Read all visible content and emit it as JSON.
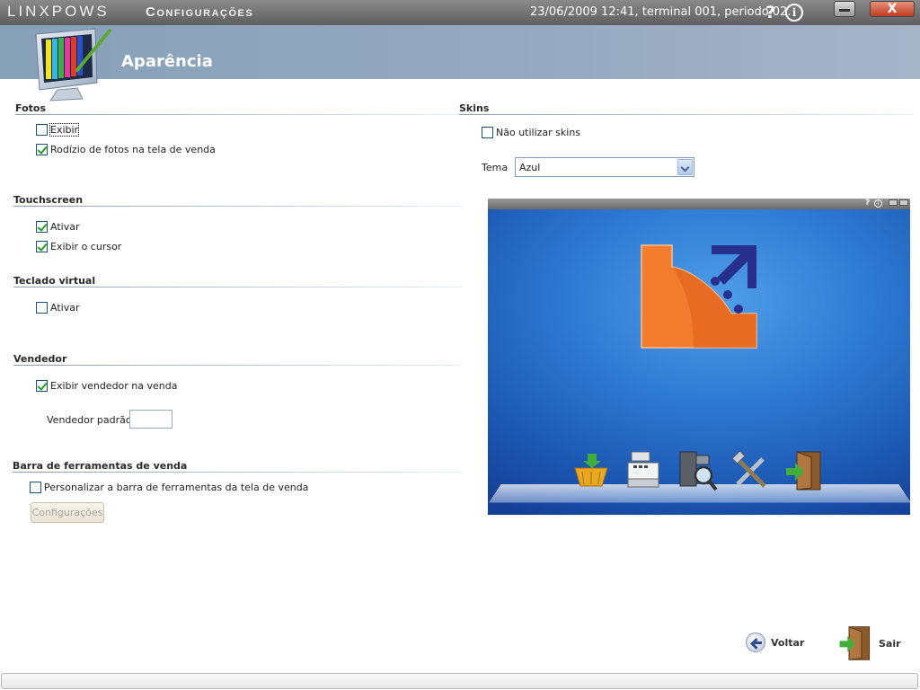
{
  "titlebar": {
    "brand": "LINXPOWS",
    "app_title": "Configurações",
    "status": "23/06/2009 12:41, terminal 001, periodo 02.",
    "help": "?",
    "info": "i",
    "close": "X"
  },
  "header": {
    "title": "Aparência"
  },
  "fotos": {
    "title": "Fotos",
    "exibir": {
      "label": "Exibir",
      "checked": false
    },
    "rodizio": {
      "label": "Rodízio de fotos na tela de venda",
      "checked": true
    }
  },
  "touchscreen": {
    "title": "Touchscreen",
    "ativar": {
      "label": "Ativar",
      "checked": true
    },
    "cursor": {
      "label": "Exibir o cursor",
      "checked": true
    }
  },
  "teclado": {
    "title": "Teclado virtual",
    "ativar": {
      "label": "Ativar",
      "checked": false
    }
  },
  "vendedor": {
    "title": "Vendedor",
    "exibir": {
      "label": "Exibir vendedor na venda",
      "checked": true
    },
    "padrao_label": "Vendedor padrão",
    "padrao_value": ""
  },
  "barra": {
    "title": "Barra de ferramentas de venda",
    "personalizar": {
      "label": "Personalizar a barra de ferramentas da tela de venda",
      "checked": false
    },
    "config_button": "Configurações"
  },
  "skins": {
    "title": "Skins",
    "nao_utilizar": {
      "label": "Não utilizar skins",
      "checked": false
    },
    "tema_label": "Tema",
    "tema_value": "Azul"
  },
  "preview": {
    "help": "?",
    "info": "i",
    "icons": [
      "basket-icon",
      "cash-register-icon",
      "search-computer-icon",
      "tools-icon",
      "exit-door-icon"
    ]
  },
  "nav": {
    "voltar": "Voltar",
    "sair": "Sair"
  },
  "colors": {
    "accent_blue": "#1a57b3",
    "logo_orange": "#f27c2e",
    "logo_navy": "#262f8c",
    "check_green": "#21a121"
  }
}
